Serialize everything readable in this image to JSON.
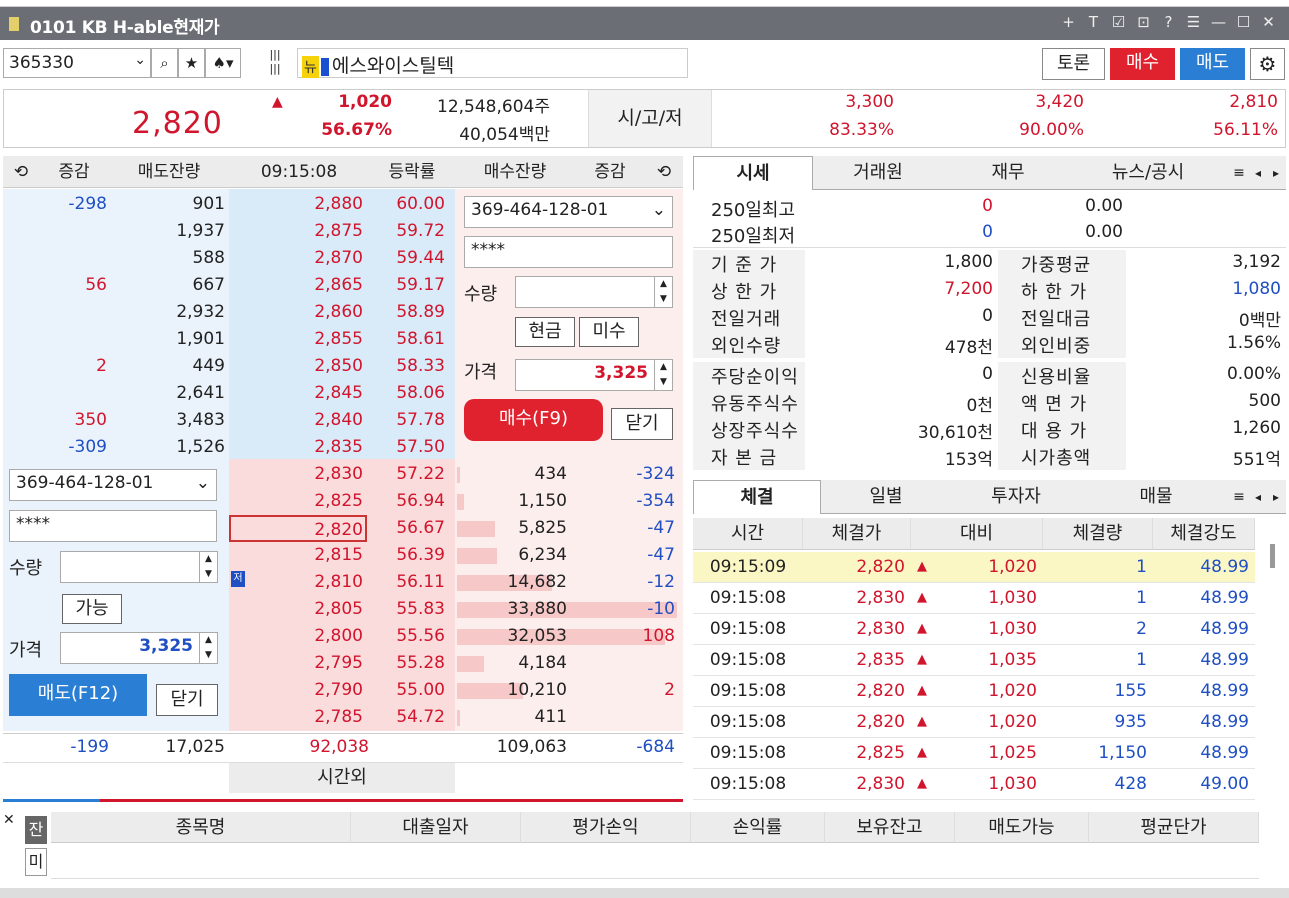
{
  "window": {
    "title": "0101 KB H-able현재가",
    "icons": [
      "+",
      "T",
      "☑",
      "⊡",
      "?",
      "☰",
      "—",
      "☐",
      "✕"
    ]
  },
  "toolbar": {
    "code": "365330",
    "new_tag": "뉴",
    "stock_name": "에스와이스틸텍",
    "discuss": "토론",
    "buy": "매수",
    "sell": "매도"
  },
  "quote": {
    "price": "2,820",
    "change": "1,020",
    "rate": "56.67%",
    "volume": "12,548,604주",
    "amount": "40,054백만",
    "sgt_label": "시/고/저",
    "open": "3,300",
    "high": "3,420",
    "low": "2,810",
    "open_rate": "83.33%",
    "high_rate": "90.00%",
    "low_rate": "56.11%"
  },
  "orderbook": {
    "headers": {
      "change": "증감",
      "sell_qty": "매도잔량",
      "time": "09:15:08",
      "rate": "등락률",
      "buy_qty": "매수잔량",
      "change2": "증감"
    },
    "asks": [
      {
        "chg": "-298",
        "qty": "901",
        "price": "2,880",
        "rate": "60.00"
      },
      {
        "chg": "",
        "qty": "1,937",
        "price": "2,875",
        "rate": "59.72"
      },
      {
        "chg": "",
        "qty": "588",
        "price": "2,870",
        "rate": "59.44"
      },
      {
        "chg": "56",
        "qty": "667",
        "price": "2,865",
        "rate": "59.17"
      },
      {
        "chg": "",
        "qty": "2,932",
        "price": "2,860",
        "rate": "58.89"
      },
      {
        "chg": "",
        "qty": "1,901",
        "price": "2,855",
        "rate": "58.61"
      },
      {
        "chg": "2",
        "qty": "449",
        "price": "2,850",
        "rate": "58.33"
      },
      {
        "chg": "",
        "qty": "2,641",
        "price": "2,845",
        "rate": "58.06"
      },
      {
        "chg": "350",
        "qty": "3,483",
        "price": "2,840",
        "rate": "57.78"
      },
      {
        "chg": "-309",
        "qty": "1,526",
        "price": "2,835",
        "rate": "57.50"
      }
    ],
    "bids": [
      {
        "price": "2,830",
        "rate": "57.22",
        "qty": "434",
        "chg": "-324"
      },
      {
        "price": "2,825",
        "rate": "56.94",
        "qty": "1,150",
        "chg": "-354"
      },
      {
        "price": "2,820",
        "rate": "56.67",
        "qty": "5,825",
        "chg": "-47"
      },
      {
        "price": "2,815",
        "rate": "56.39",
        "qty": "6,234",
        "chg": "-47"
      },
      {
        "price": "2,810",
        "rate": "56.11",
        "qty": "14,682",
        "chg": "-12"
      },
      {
        "price": "2,805",
        "rate": "55.83",
        "qty": "33,880",
        "chg": "-10"
      },
      {
        "price": "2,800",
        "rate": "55.56",
        "qty": "32,053",
        "chg": "108"
      },
      {
        "price": "2,795",
        "rate": "55.28",
        "qty": "4,184",
        "chg": ""
      },
      {
        "price": "2,790",
        "rate": "55.00",
        "qty": "10,210",
        "chg": "2"
      },
      {
        "price": "2,785",
        "rate": "54.72",
        "qty": "411",
        "chg": ""
      }
    ],
    "totals": {
      "sell_chg": "-199",
      "sell_qty": "17,025",
      "mid": "92,038",
      "buy_qty": "109,063",
      "buy_chg": "-684"
    },
    "after_hours": "시간외"
  },
  "buy_order": {
    "account": "369-464-128-01",
    "password": "****",
    "qty_label": "수량",
    "cash": "현금",
    "credit": "미수",
    "price_label": "가격",
    "price": "3,325",
    "submit": "매수(F9)",
    "close": "닫기"
  },
  "sell_order": {
    "account": "369-464-128-01",
    "password": "****",
    "qty_label": "수량",
    "avail": "가능",
    "price_label": "가격",
    "price": "3,325",
    "submit": "매도(F12)",
    "close": "닫기",
    "mark": "저"
  },
  "info_tabs": {
    "tabs": [
      "시세",
      "거래원",
      "재무",
      "뉴스/공시"
    ]
  },
  "info": {
    "r250": [
      {
        "label": "250일최고",
        "val": "0",
        "pct": "0.00"
      },
      {
        "label": "250일최저",
        "val": "0",
        "pct": "0.00"
      }
    ],
    "rows": [
      {
        "l1": "기 준 가",
        "v1": "1,800",
        "l2": "가중평균",
        "v2": "3,192"
      },
      {
        "l1": "상 한 가",
        "v1": "7,200",
        "l2": "하 한 가",
        "v2": "1,080"
      },
      {
        "l1": "전일거래",
        "v1": "0",
        "l2": "전일대금",
        "v2": "0백만"
      },
      {
        "l1": "외인수량",
        "v1": "478천",
        "l2": "외인비중",
        "v2": "1.56%"
      },
      {
        "l1": "주당순이익",
        "v1": "0",
        "l2": "신용비율",
        "v2": "0.00%"
      },
      {
        "l1": "유동주식수",
        "v1": "0천",
        "l2": "액 면 가",
        "v2": "500"
      },
      {
        "l1": "상장주식수",
        "v1": "30,610천",
        "l2": "대 용 가",
        "v2": "1,260"
      },
      {
        "l1": "자 본 금",
        "v1": "153억",
        "l2": "시가총액",
        "v2": "551억"
      }
    ]
  },
  "trade_tabs": {
    "tabs": [
      "체결",
      "일별",
      "투자자",
      "매물"
    ]
  },
  "trades": {
    "headers": [
      "시간",
      "체결가",
      "대비",
      "체결량",
      "체결강도"
    ],
    "rows": [
      {
        "time": "09:15:09",
        "price": "2,820",
        "diff": "1,020",
        "qty": "1",
        "str": "48.99"
      },
      {
        "time": "09:15:08",
        "price": "2,830",
        "diff": "1,030",
        "qty": "1",
        "str": "48.99"
      },
      {
        "time": "09:15:08",
        "price": "2,830",
        "diff": "1,030",
        "qty": "2",
        "str": "48.99"
      },
      {
        "time": "09:15:08",
        "price": "2,835",
        "diff": "1,035",
        "qty": "1",
        "str": "48.99"
      },
      {
        "time": "09:15:08",
        "price": "2,820",
        "diff": "1,020",
        "qty": "155",
        "str": "48.99"
      },
      {
        "time": "09:15:08",
        "price": "2,820",
        "diff": "1,020",
        "qty": "935",
        "str": "48.99"
      },
      {
        "time": "09:15:08",
        "price": "2,825",
        "diff": "1,025",
        "qty": "1,150",
        "str": "48.99"
      },
      {
        "time": "09:15:08",
        "price": "2,830",
        "diff": "1,030",
        "qty": "428",
        "str": "49.00"
      }
    ]
  },
  "balance": {
    "side": [
      "잔",
      "미"
    ],
    "headers": [
      "종목명",
      "대출일자",
      "평가손익",
      "손익률",
      "보유잔고",
      "매도가능",
      "평균단가"
    ]
  },
  "colors": {
    "red": "#d0152d",
    "blue": "#1f4fc2",
    "buy_btn": "#e0222e",
    "sell_btn": "#2a7fd4"
  }
}
